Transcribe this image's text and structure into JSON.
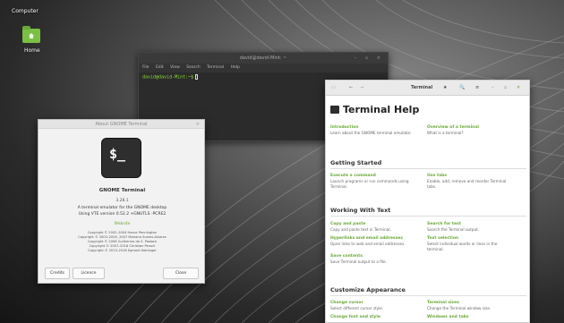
{
  "desktop": {
    "computer_label": "Computer",
    "home_label": "Home"
  },
  "terminal": {
    "title": "david@david-Mint: ~",
    "window_controls": "– ▫ ×",
    "menu": [
      "File",
      "Edit",
      "View",
      "Search",
      "Terminal",
      "Help"
    ],
    "prompt": "david@david-Mint:~$"
  },
  "about": {
    "title": "About GNOME Terminal",
    "close_glyph": "×",
    "icon_text": "$_",
    "app_name": "GNOME Terminal",
    "version": "3.28.1",
    "desc_line1": "A terminal emulator for the GNOME desktop",
    "desc_line2": "Using VTE version 0.52.2 +GNUTLS -PCRE2",
    "website": "Website",
    "copyright": [
      "Copyright © 2002–2004 Havoc Pennington",
      "Copyright © 2003–2004, 2007 Mariano Suárez-Alvarez",
      "Copyright © 2006 Guilherme de S. Pastore",
      "Copyright © 2007–2018 Christian Persch",
      "Copyright © 2013–2018 Egmont Koblinger"
    ],
    "credits_label": "Credits",
    "licence_label": "Licence",
    "close_label": "Close"
  },
  "help": {
    "header": {
      "sidebar": "▭",
      "back": "←",
      "forward": "→",
      "title": "Terminal",
      "star": "★",
      "search": "🔍",
      "menu": "≡",
      "minimize": "–",
      "maximize": "▫",
      "close": "✕"
    },
    "h1": "Terminal Help",
    "intro": [
      {
        "link": "Introduction",
        "desc": "Learn about the GNOME terminal emulator."
      },
      {
        "link": "Overview of a terminal",
        "desc": "What is a terminal?"
      }
    ],
    "sections": [
      {
        "title": "Getting Started",
        "items": [
          {
            "link": "Execute a command",
            "desc": "Launch programs or run commands using Terminal."
          },
          {
            "link": "Use tabs",
            "desc": "Enable, add, remove and reorder Terminal tabs."
          }
        ]
      },
      {
        "title": "Working With Text",
        "items": [
          {
            "link": "Copy and paste",
            "desc": "Copy and paste text in Terminal."
          },
          {
            "link": "Search for text",
            "desc": "Search the Terminal output."
          },
          {
            "link": "Hyperlinks and email addresses",
            "desc": "Open links to web and email addresses."
          },
          {
            "link": "Text selection",
            "desc": "Select individual words or lines in the terminal."
          },
          {
            "link": "Save contents",
            "desc": "Save Terminal output to a file."
          }
        ]
      },
      {
        "title": "Customize Appearance",
        "items": [
          {
            "link": "Change cursor",
            "desc": "Select different cursor style."
          },
          {
            "link": "Terminal sizes",
            "desc": "Change the Terminal window size."
          },
          {
            "link": "Change font and style",
            "desc": ""
          },
          {
            "link": "Windows and tabs",
            "desc": ""
          }
        ]
      }
    ]
  }
}
